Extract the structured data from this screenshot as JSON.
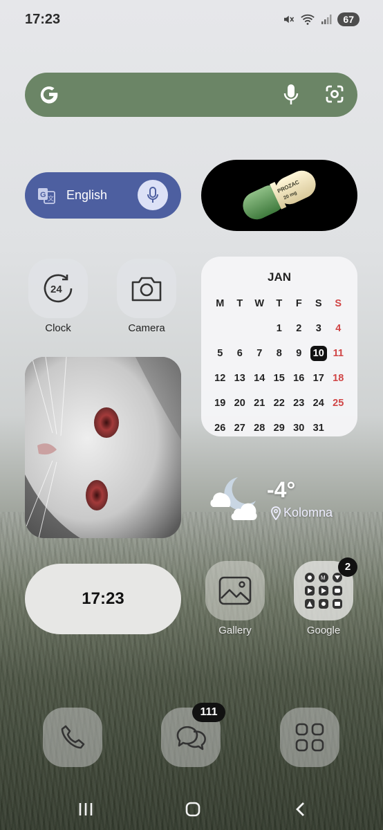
{
  "status_bar": {
    "time": "17:23",
    "battery": "67"
  },
  "search_bar": {
    "logo": "G",
    "icons": [
      "mic-icon",
      "lens-icon"
    ]
  },
  "translate_widget": {
    "language": "English"
  },
  "pill_widget": {
    "text_line1": "PROZAC",
    "text_line2": "20 mg"
  },
  "apps": {
    "clock": {
      "label": "Clock",
      "icon_text": "24"
    },
    "camera": {
      "label": "Camera"
    },
    "gallery": {
      "label": "Gallery"
    },
    "google": {
      "label": "Google",
      "badge": "2"
    }
  },
  "calendar": {
    "month": "JAN",
    "weekdays": [
      "M",
      "T",
      "W",
      "T",
      "F",
      "S",
      "S"
    ],
    "weeks": [
      [
        "",
        "",
        "",
        "1",
        "2",
        "3",
        "4"
      ],
      [
        "5",
        "6",
        "7",
        "8",
        "9",
        "10",
        "11"
      ],
      [
        "12",
        "13",
        "14",
        "15",
        "16",
        "17",
        "18"
      ],
      [
        "19",
        "20",
        "21",
        "22",
        "23",
        "24",
        "25"
      ],
      [
        "26",
        "27",
        "28",
        "29",
        "30",
        "31",
        ""
      ]
    ],
    "today": "10",
    "colors": {
      "sunday": "#d04545",
      "today_bg": "#111111"
    }
  },
  "weather": {
    "temperature": "-4°",
    "location": "Kolomna"
  },
  "clock_widget": {
    "time": "17:23"
  },
  "dock": {
    "messages_badge": "111",
    "items": [
      "phone-icon",
      "messages-icon",
      "apps-icon"
    ]
  },
  "colors": {
    "search_bar": "#6b8566",
    "translate": "#4d5fa0"
  }
}
